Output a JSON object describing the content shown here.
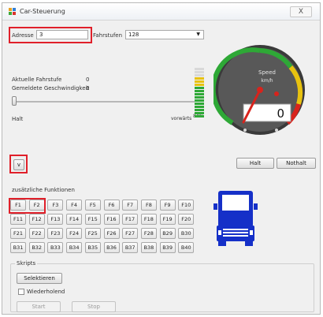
{
  "window": {
    "title": "Car-Steuerung",
    "close_label": "X"
  },
  "address": {
    "label": "Adresse",
    "value": "3"
  },
  "speed_steps": {
    "label": "Fahrstufen",
    "value": "128"
  },
  "current_step": {
    "label": "Aktuelle Fahrstufe",
    "value": "0"
  },
  "reported_speed": {
    "label": "Gemeldete Geschwindigkeit",
    "value": "0"
  },
  "slider": {
    "value": 0
  },
  "halt_text": "Halt",
  "direction": {
    "label": "vorwärts",
    "percent": "84%",
    "level": 0.84
  },
  "gauge": {
    "title_line1": "Speed",
    "title_line2": "km/h",
    "digital_value": "0",
    "needle_value": 0
  },
  "buttons": {
    "halt": "Halt",
    "emergency": "Nothalt",
    "direction_toggle": "v"
  },
  "functions": {
    "title": "zusätzliche Funktionen",
    "rows": [
      [
        "F1",
        "F2",
        "F3",
        "F4",
        "F5",
        "F6",
        "F7",
        "F8",
        "F9",
        "F10"
      ],
      [
        "F11",
        "F12",
        "F13",
        "F14",
        "F15",
        "F16",
        "F17",
        "F18",
        "F19",
        "F20"
      ],
      [
        "F21",
        "F22",
        "F23",
        "F24",
        "F25",
        "F26",
        "F27",
        "F28",
        "B29",
        "B30"
      ],
      [
        "B31",
        "B32",
        "B33",
        "B34",
        "B35",
        "B36",
        "B37",
        "B38",
        "B39",
        "B40"
      ]
    ]
  },
  "scripts": {
    "title": "Skripts",
    "select_label": "Selektieren",
    "repeat_label": "Wiederholend",
    "start_label": "Start",
    "stop_label": "Stop"
  },
  "colors": {
    "highlight": "#e0202a",
    "truck": "#1530c8",
    "gauge_green": "#2ea836",
    "gauge_yellow": "#e8c20f",
    "gauge_red": "#d8231c"
  },
  "icons": {
    "truck": "truck-front-icon",
    "app": "app-grid-icon"
  }
}
